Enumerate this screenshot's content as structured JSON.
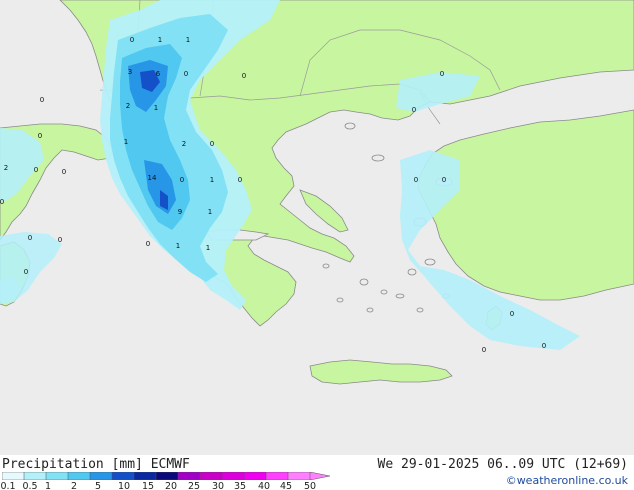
{
  "footer": {
    "product": "Precipitation [mm] ECMWF",
    "datetime": "We 29-01-2025 06..09 UTC (12+69)",
    "credit": "©weatheronline.co.uk"
  },
  "legend": {
    "labels": [
      "0.1",
      "0.5",
      "1",
      "2",
      "5",
      "10",
      "15",
      "20",
      "25",
      "30",
      "35",
      "40",
      "45",
      "50"
    ],
    "colors": [
      "#e6f9fd",
      "#b4f0fa",
      "#82e1f5",
      "#50c8f0",
      "#2896e6",
      "#1450c8",
      "#0a28a0",
      "#0a0a78",
      "#a000c8",
      "#c800c8",
      "#dc00dc",
      "#f000f0",
      "#ff40ff",
      "#ff80ff"
    ]
  },
  "colors": {
    "sea": "#ececec",
    "land": "#c8f5a0",
    "coast": "#8a8a8a",
    "border": "#9a9a9a",
    "rain_light": "#b4f0fa",
    "rain_mid": "#82e1f5",
    "rain_heavy": "#50c8f0",
    "rain_core": "#2896e6",
    "rain_max": "#1450c8"
  },
  "map_labels": [
    {
      "text": "0",
      "kind": "precip-value"
    },
    {
      "text": "1",
      "kind": "precip-value"
    },
    {
      "text": "1",
      "kind": "precip-value"
    },
    {
      "text": "3",
      "kind": "precip-value"
    },
    {
      "text": "6",
      "kind": "precip-value"
    },
    {
      "text": "0",
      "kind": "precip-value"
    },
    {
      "text": "0",
      "kind": "precip-value"
    },
    {
      "text": "2",
      "kind": "precip-value"
    },
    {
      "text": "1",
      "kind": "precip-value"
    },
    {
      "text": "0",
      "kind": "precip-value"
    },
    {
      "text": "0",
      "kind": "precip-value"
    },
    {
      "text": "1",
      "kind": "precip-value"
    },
    {
      "text": "2",
      "kind": "precip-value"
    },
    {
      "text": "0",
      "kind": "precip-value"
    },
    {
      "text": "14",
      "kind": "precip-value"
    },
    {
      "text": "0",
      "kind": "precip-value"
    },
    {
      "text": "1",
      "kind": "precip-value"
    },
    {
      "text": "0",
      "kind": "precip-value"
    },
    {
      "text": "9",
      "kind": "precip-value"
    },
    {
      "text": "1",
      "kind": "precip-value"
    },
    {
      "text": "0",
      "kind": "precip-value"
    },
    {
      "text": "2",
      "kind": "precip-value"
    },
    {
      "text": "0",
      "kind": "precip-value"
    },
    {
      "text": "0",
      "kind": "precip-value"
    },
    {
      "text": "0",
      "kind": "precip-value"
    },
    {
      "text": "0",
      "kind": "precip-value"
    },
    {
      "text": "0",
      "kind": "precip-value"
    },
    {
      "text": "1",
      "kind": "precip-value"
    },
    {
      "text": "1",
      "kind": "precip-value"
    },
    {
      "text": "0",
      "kind": "precip-value"
    },
    {
      "text": "0",
      "kind": "precip-value"
    },
    {
      "text": "0",
      "kind": "precip-value"
    },
    {
      "text": "0",
      "kind": "precip-value"
    },
    {
      "text": "0",
      "kind": "precip-value"
    },
    {
      "text": "0",
      "kind": "precip-value"
    },
    {
      "text": "0",
      "kind": "precip-value"
    },
    {
      "text": "0",
      "kind": "precip-value"
    }
  ]
}
